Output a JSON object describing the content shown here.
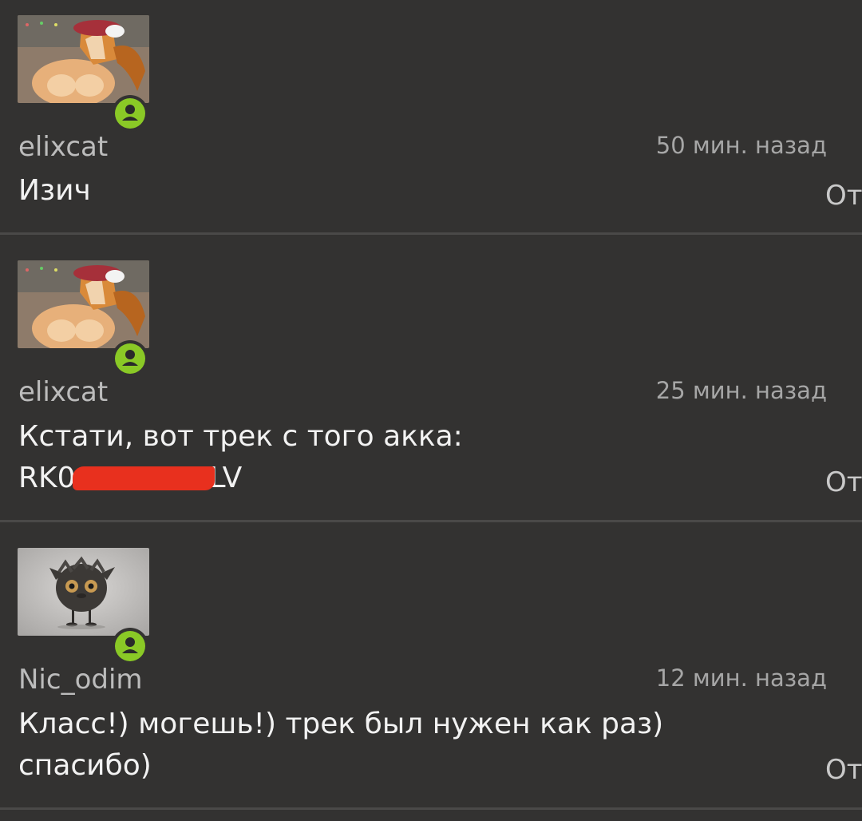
{
  "messages": [
    {
      "username": "elixcat",
      "time": "50 мин. назад",
      "lines": [
        "Изич"
      ],
      "reply_label": "От",
      "avatar": "fox-avatar-image"
    },
    {
      "username": "elixcat",
      "time": "25 мин. назад",
      "lines": [
        "Кстати, вот трек с того акка:"
      ],
      "track_prefix": "RK0",
      "track_suffix": "LV",
      "reply_label": "От",
      "avatar": "fox-avatar-image"
    },
    {
      "username": "Nic_odim",
      "time": "12 мин. назад",
      "lines": [
        "Класс!) могешь!) трек был нужен как раз)",
        "спасибо)"
      ],
      "reply_label": "От",
      "avatar": "fluffy-creature-avatar-image"
    }
  ],
  "colors": {
    "background": "#333231",
    "status_online": "#8ac926",
    "redaction": "#e8301e"
  }
}
